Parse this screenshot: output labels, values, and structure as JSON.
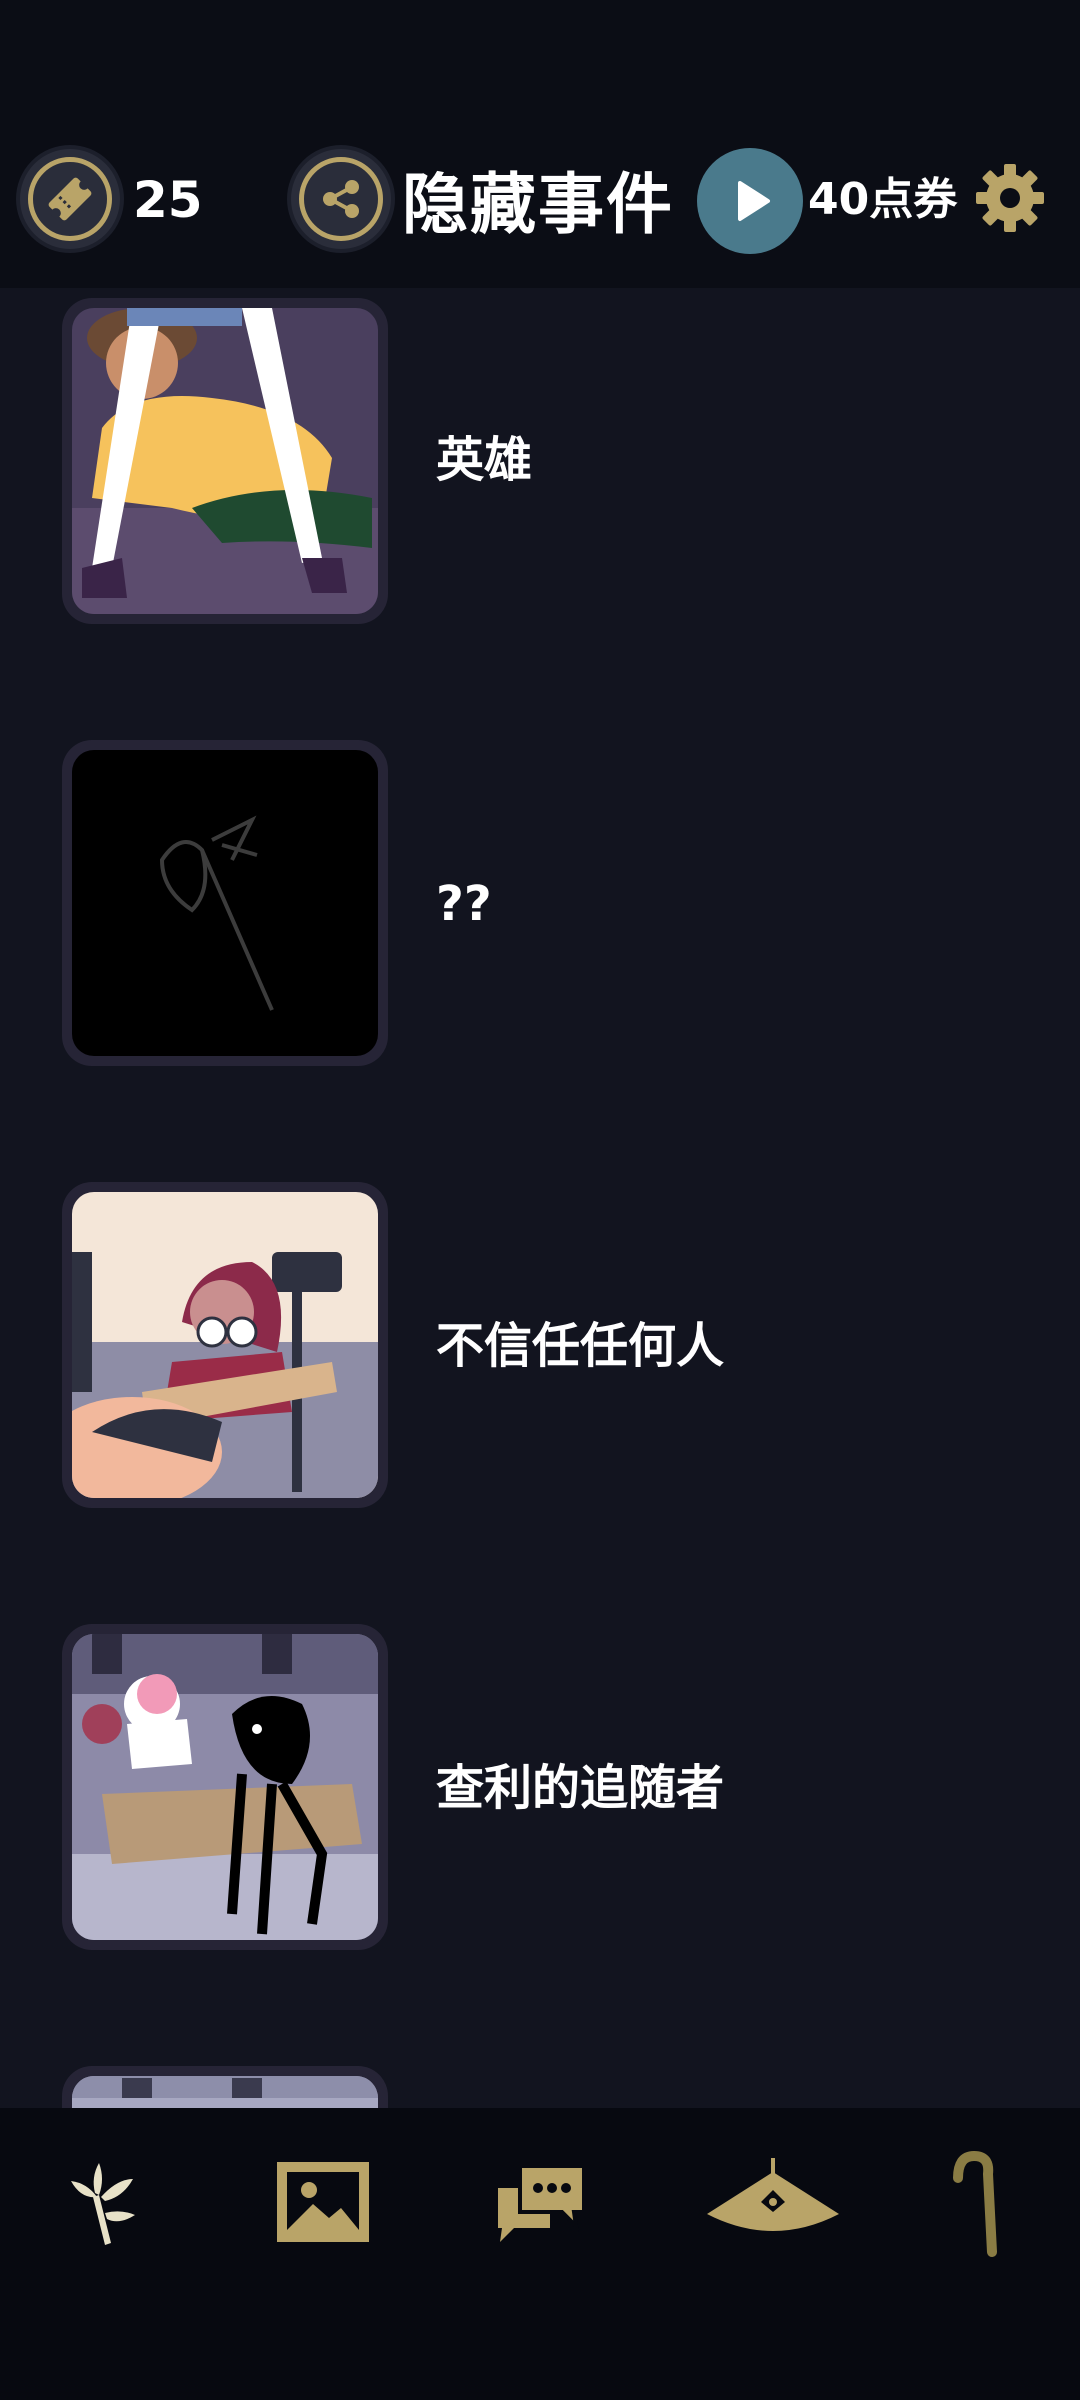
{
  "header": {
    "ticket_count": "25",
    "title": "隐藏事件",
    "coupon_label": "40点券"
  },
  "events": [
    {
      "label": "英雄"
    },
    {
      "label": "??"
    },
    {
      "label": "不信任任何人"
    },
    {
      "label": "查利的追随者"
    },
    {
      "label": ""
    }
  ],
  "colors": {
    "background": "#12141f",
    "header_bg": "#0b0d15",
    "accent_gold": "#b9a468",
    "play_button": "#4a7a8c",
    "nav_bg": "#070910"
  },
  "nav": {
    "icons": [
      "flower-icon",
      "gallery-icon",
      "chat-icon",
      "lamp-icon",
      "cane-icon"
    ]
  }
}
